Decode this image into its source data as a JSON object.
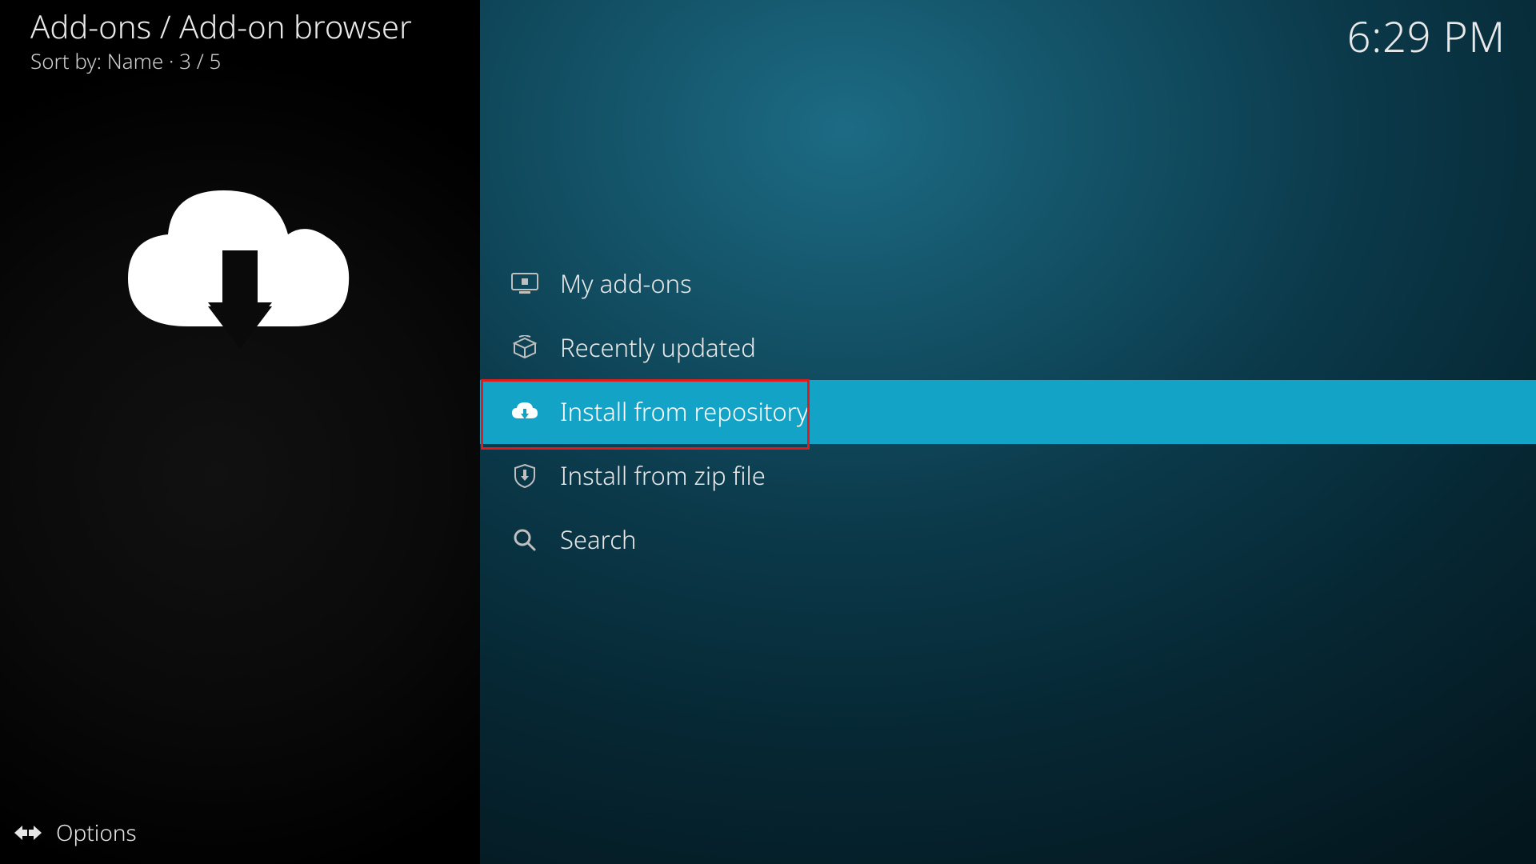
{
  "header": {
    "breadcrumb": "Add-ons / Add-on browser",
    "sortline": "Sort by: Name  ·  3 / 5",
    "clock": "6:29 PM"
  },
  "menu": {
    "items": [
      {
        "icon": "monitor-icon",
        "label": "My add-ons"
      },
      {
        "icon": "open-box-icon",
        "label": "Recently updated"
      },
      {
        "icon": "cloud-download-small-icon",
        "label": "Install from repository",
        "selected": true,
        "annotated": true
      },
      {
        "icon": "shield-download-icon",
        "label": "Install from zip file"
      },
      {
        "icon": "search-icon",
        "label": "Search"
      }
    ]
  },
  "footer": {
    "options_label": "Options"
  },
  "colors": {
    "highlight": "#12a3c7",
    "annotation": "#e11b1b",
    "text": "#e6e6e6"
  }
}
